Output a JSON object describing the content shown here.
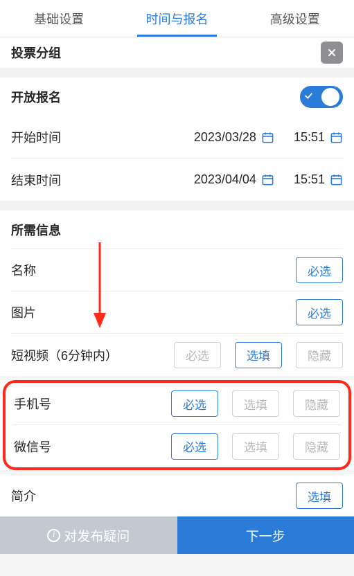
{
  "tabs": {
    "basic": "基础设置",
    "time_enroll": "时间与报名",
    "advanced": "高级设置"
  },
  "voting_group": {
    "label": "投票分组"
  },
  "open_enroll": {
    "label": "开放报名"
  },
  "start_time": {
    "label": "开始时间",
    "date": "2023/03/28",
    "time": "15:51"
  },
  "end_time": {
    "label": "结束时间",
    "date": "2023/04/04",
    "time": "15:51"
  },
  "required_info": {
    "heading": "所需信息"
  },
  "fields": {
    "name": {
      "label": "名称",
      "required": "必选"
    },
    "image": {
      "label": "图片",
      "required": "必选"
    },
    "short_video": {
      "label": "短视频（6分钟内）"
    },
    "phone": {
      "label": "手机号"
    },
    "wechat": {
      "label": "微信号"
    },
    "intro": {
      "label": "简介",
      "optional_label": "选填"
    }
  },
  "option_labels": {
    "required": "必选",
    "optional": "选填",
    "hidden": "隐藏"
  },
  "footer": {
    "question": "对发布疑问",
    "next": "下一步"
  }
}
